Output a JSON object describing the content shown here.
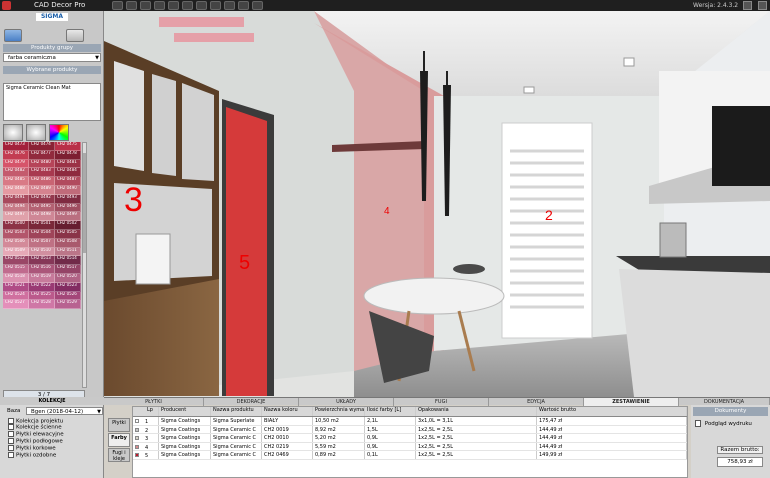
{
  "app": {
    "title": "CAD Decor Pro",
    "version": "Wersja: 2.4.3.2",
    "brand": "SIGMA"
  },
  "left": {
    "group_header": "Produkty grupy",
    "group_value": "farba ceramiczna",
    "selected_header": "Wybrane produkty",
    "selected_item": "Sigma Ceramic Clean Mat",
    "pager": "3 / 7",
    "swatches": [
      {
        "t": "CH2 0473",
        "c": "#a3213b"
      },
      {
        "t": "CH2 0474",
        "c": "#8a2235"
      },
      {
        "t": "CH2 0475",
        "c": "#b93048"
      },
      {
        "t": "CH2 0476",
        "c": "#c33d52"
      },
      {
        "t": "CH2 0477",
        "c": "#912a3d"
      },
      {
        "t": "CH2 0478",
        "c": "#7d1f32"
      },
      {
        "t": "CH2 0479",
        "c": "#d6546a"
      },
      {
        "t": "CH2 0480",
        "c": "#b64458"
      },
      {
        "t": "CH2 0481",
        "c": "#9b3246"
      },
      {
        "t": "CH2 0482",
        "c": "#c45b6d"
      },
      {
        "t": "CH2 0483",
        "c": "#a8394f"
      },
      {
        "t": "CH2 0484",
        "c": "#8e2a3f"
      },
      {
        "t": "CH2 0485",
        "c": "#d97a86"
      },
      {
        "t": "CH2 0486",
        "c": "#c96473"
      },
      {
        "t": "CH2 0487",
        "c": "#b14b5e"
      },
      {
        "t": "CH2 0488",
        "c": "#e59aa2"
      },
      {
        "t": "CH2 0489",
        "c": "#d5838f"
      },
      {
        "t": "CH2 0490",
        "c": "#c06b7a"
      },
      {
        "t": "CH2 0491",
        "c": "#a84a5d"
      },
      {
        "t": "CH2 0492",
        "c": "#94394e"
      },
      {
        "t": "CH2 0493",
        "c": "#7f2b41"
      },
      {
        "t": "CH2 0494",
        "c": "#c77a87"
      },
      {
        "t": "CH2 0495",
        "c": "#b46273"
      },
      {
        "t": "CH2 0496",
        "c": "#9f4d60"
      },
      {
        "t": "CH2 0497",
        "c": "#e0a1aa"
      },
      {
        "t": "CH2 0498",
        "c": "#cf8796"
      },
      {
        "t": "CH2 0499",
        "c": "#ba6f80"
      },
      {
        "t": "CH2 0500",
        "c": "#8d3346"
      },
      {
        "t": "CH2 0501",
        "c": "#7a2839"
      },
      {
        "t": "CH2 0502",
        "c": "#661e30"
      },
      {
        "t": "CH2 0503",
        "c": "#b3566b"
      },
      {
        "t": "CH2 0504",
        "c": "#9f4459"
      },
      {
        "t": "CH2 0505",
        "c": "#8a3448"
      },
      {
        "t": "CH2 0506",
        "c": "#d38a99"
      },
      {
        "t": "CH2 0507",
        "c": "#bf7184"
      },
      {
        "t": "CH2 0508",
        "c": "#a95a6d"
      },
      {
        "t": "CH2 0509",
        "c": "#e6a9b7"
      },
      {
        "t": "CH2 0510",
        "c": "#d18fa0"
      },
      {
        "t": "CH2 0511",
        "c": "#bb7689"
      },
      {
        "t": "CH2 0512",
        "c": "#9a4767"
      },
      {
        "t": "CH2 0513",
        "c": "#863758"
      },
      {
        "t": "CH2 0514",
        "c": "#712a49"
      },
      {
        "t": "CH2 0515",
        "c": "#c06b8e"
      },
      {
        "t": "CH2 0516",
        "c": "#ab567a"
      },
      {
        "t": "CH2 0517",
        "c": "#944467"
      },
      {
        "t": "CH2 0518",
        "c": "#db92b0"
      },
      {
        "t": "CH2 0519",
        "c": "#c77a9b"
      },
      {
        "t": "CH2 0520",
        "c": "#b06385"
      },
      {
        "t": "CH2 0521",
        "c": "#b04c86"
      },
      {
        "t": "CH2 0522",
        "c": "#9a3a74"
      },
      {
        "t": "CH2 0523",
        "c": "#832c62"
      },
      {
        "t": "CH2 0524",
        "c": "#d0709f"
      },
      {
        "t": "CH2 0525",
        "c": "#bb5a8c"
      },
      {
        "t": "CH2 0526",
        "c": "#a44779"
      },
      {
        "t": "CH2 0527",
        "c": "#e48fba"
      },
      {
        "t": "CH2 0528",
        "c": "#cf77a6"
      },
      {
        "t": "CH2 0529",
        "c": "#b86291"
      }
    ]
  },
  "tabs": [
    "PŁYTKI",
    "DEKORACJE",
    "UKŁADY",
    "FUGI",
    "EDYCJA",
    "ZESTAWIENIE",
    "DOKUMENTACJA"
  ],
  "collections": {
    "header": "KOLEKCJE",
    "base_label": "Baza",
    "base_value": "Bgen (2018-04-12)",
    "items": [
      "Kolekcja projektu",
      "Kolekcje ścienne",
      "Płytki elewacyjne",
      "Płytki podłogowe",
      "Płytki korkowe",
      "Płytki ozdobne"
    ]
  },
  "vtabs": [
    "Płytki",
    "Farby",
    "Fugi i kleje"
  ],
  "table": {
    "headers": [
      "Lp",
      "Producent",
      "Nazwa produktu",
      "Nazwa koloru",
      "Powierzchnia wymalowania",
      "Ilość farby [L]",
      "Opakowania",
      "Wartość brutto"
    ],
    "rows": [
      {
        "lp": "1",
        "sw": "#ffffff",
        "producent": "Sigma Coatings",
        "produkt": "Sigma Superlate",
        "kolor": "BIAŁY",
        "pow": "10,50 m2",
        "ilosc": "2,1L",
        "opak": "3x1,0L = 3,1L",
        "wartosc": "175,47 zł"
      },
      {
        "lp": "2",
        "sw": "#c7c7c7",
        "producent": "Sigma Coatings",
        "produkt": "Sigma Ceramic C",
        "kolor": "CH2 0019",
        "pow": "8,92 m2",
        "ilosc": "1,5L",
        "opak": "1x2,5L = 2,5L",
        "wartosc": "144,49 zł"
      },
      {
        "lp": "3",
        "sw": "#d9d4c9",
        "producent": "Sigma Coatings",
        "produkt": "Sigma Ceramic C",
        "kolor": "CH2 0010",
        "pow": "5,20 m2",
        "ilosc": "0,9L",
        "opak": "1x2,5L = 2,5L",
        "wartosc": "144,49 zł"
      },
      {
        "lp": "4",
        "sw": "#d98a8c",
        "producent": "Sigma Coatings",
        "produkt": "Sigma Ceramic C",
        "kolor": "CH2 0219",
        "pow": "5,59 m2",
        "ilosc": "0,9L",
        "opak": "1x2,5L = 2,5L",
        "wartosc": "144,49 zł"
      },
      {
        "lp": "5",
        "sw": "#c0182c",
        "producent": "Sigma Coatings",
        "produkt": "Sigma Ceramic C",
        "kolor": "CH2 0469",
        "pow": "0,89 m2",
        "ilosc": "0,1L",
        "opak": "1x2,5L = 2,5L",
        "wartosc": "149,99 zł"
      }
    ]
  },
  "right": {
    "header": "Dokumenty",
    "item": "Podgląd wydruku",
    "total_label": "Razem brutto:",
    "total_value": "758,93 zł"
  },
  "scene_labels": {
    "l2": "2",
    "l3": "3",
    "l4": "4",
    "l5": "5"
  }
}
